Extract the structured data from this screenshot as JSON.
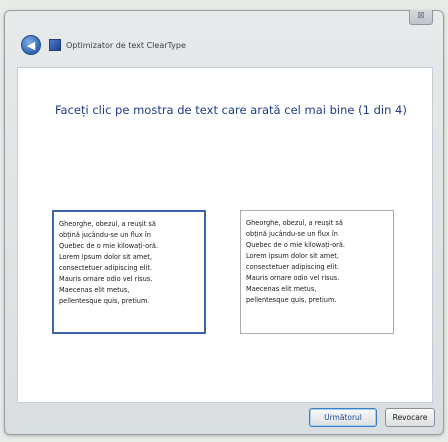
{
  "window": {
    "close_label": "⊠"
  },
  "titlebar": {
    "title": "Optimizator de text ClearType",
    "back_label": "◀"
  },
  "main": {
    "heading": "Faceți clic pe mostra de text care arată cel mai bine (1 din 4)",
    "samples": [
      {
        "text": "Gheorghe, obezul, a reușit să\nobțină jucându-se un flux în\nQuebec de o mie kilowați-oră.\nLorem ipsum dolor sit amet,\nconsectetuer adipiscing elit.\nMauris ornare odio vel risus.\nMaecenas elit metus,\npellentesque quis, pretium.",
        "selected": true
      },
      {
        "text": "Gheorghe, obezul, a reușit să\nobțină jucându-se un flux în\nQuebec de o mie kilowați-oră.\nLorem ipsum dolor sit amet,\nconsectetuer adipiscing elit.\nMauris ornare odio vel risus.\nMaecenas elit metus,\npellentesque quis, pretium.",
        "selected": false
      }
    ]
  },
  "footer": {
    "next_label": "Următorul",
    "cancel_label": "Revocare"
  },
  "colors": {
    "heading": "#1f3c8a",
    "selected_border": "#3e63a8",
    "background": "#e9ebe8"
  }
}
